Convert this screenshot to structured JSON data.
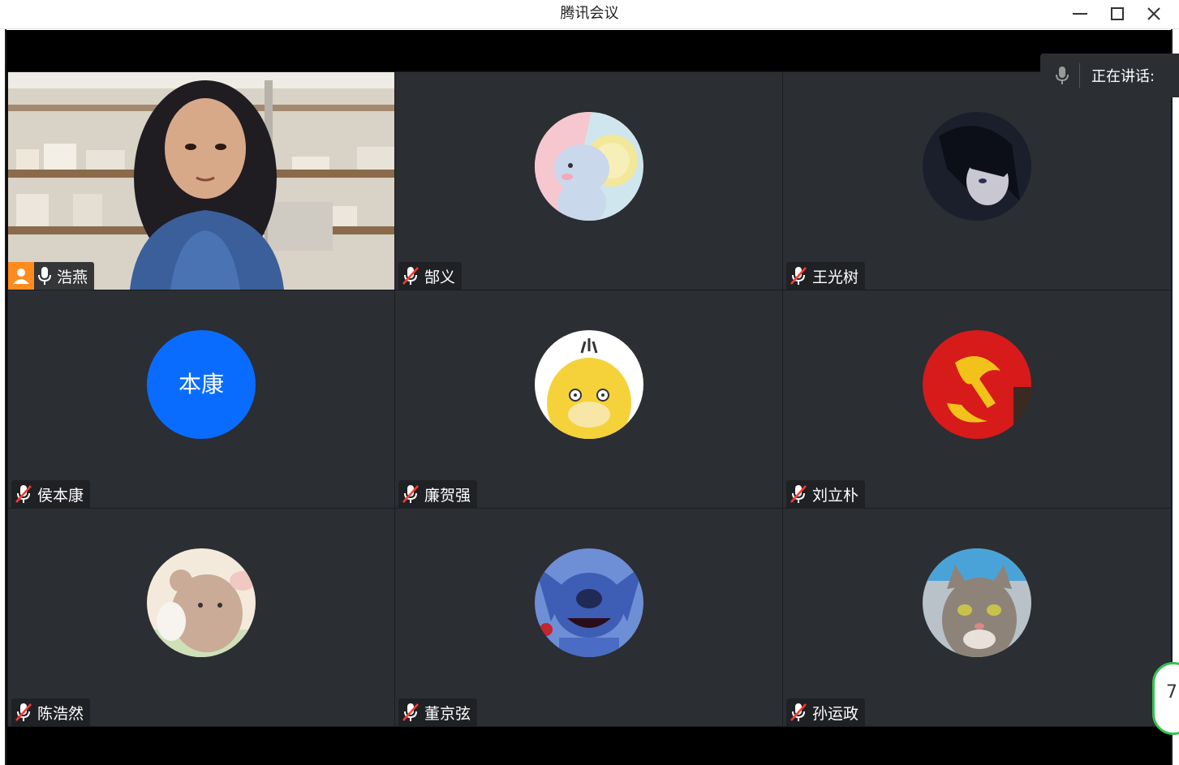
{
  "window": {
    "title": "腾讯会议",
    "minimize_icon": "minimize-icon",
    "maximize_icon": "maximize-icon",
    "close_icon": "close-icon"
  },
  "speaking_indicator": {
    "icon": "microphone-icon",
    "label": "正在讲话:"
  },
  "participants": [
    {
      "name": "浩燕",
      "muted": false,
      "host": true,
      "video": true
    },
    {
      "name": "郜义",
      "muted": true,
      "avatar": "mouse-avatar"
    },
    {
      "name": "王光树",
      "muted": true,
      "avatar": "anime-boy-avatar"
    },
    {
      "name": "侯本康",
      "muted": true,
      "initials": "本康"
    },
    {
      "name": "廉贺强",
      "muted": true,
      "avatar": "duck-avatar"
    },
    {
      "name": "刘立朴",
      "muted": true,
      "avatar": "party-emblem-avatar"
    },
    {
      "name": "陈浩然",
      "muted": true,
      "avatar": "bear-avatar"
    },
    {
      "name": "董京弦",
      "muted": true,
      "avatar": "stitch-avatar"
    },
    {
      "name": "孙运政",
      "muted": true,
      "avatar": "cat-avatar"
    }
  ],
  "network_badge": {
    "value": "7"
  },
  "colors": {
    "tile_bg": "#2b2e32",
    "host_badge": "#ff8a1e",
    "initials_bg": "#0a6cff",
    "muted_slash": "#ff3b30"
  }
}
